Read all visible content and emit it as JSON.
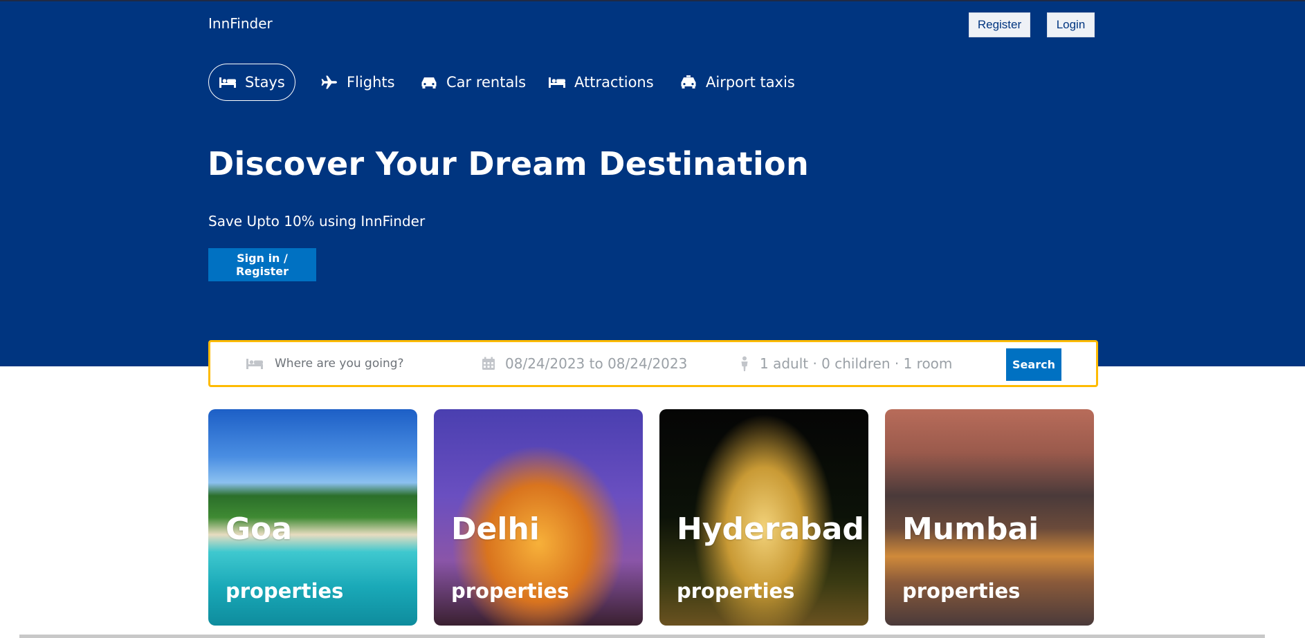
{
  "header": {
    "logo": "InnFinder",
    "register_label": "Register",
    "login_label": "Login"
  },
  "nav": {
    "items": [
      {
        "label": "Stays",
        "icon": "bed-icon",
        "active": true
      },
      {
        "label": "Flights",
        "icon": "plane-icon"
      },
      {
        "label": "Car rentals",
        "icon": "car-icon"
      },
      {
        "label": "Attractions",
        "icon": "bed-icon"
      },
      {
        "label": "Airport taxis",
        "icon": "taxi-icon"
      }
    ]
  },
  "hero": {
    "title": "Discover Your Dream Destination",
    "subtitle": "Save Upto 10% using InnFinder",
    "cta_label": "Sign in / Register"
  },
  "search": {
    "destination_placeholder": "Where are you going?",
    "dates": "08/24/2023 to 08/24/2023",
    "guests": "1 adult · 0 children · 1 room",
    "button_label": "Search"
  },
  "cities": [
    {
      "name": "Goa",
      "sub": "properties"
    },
    {
      "name": "Delhi",
      "sub": "properties"
    },
    {
      "name": "Hyderabad",
      "sub": "properties"
    },
    {
      "name": "Mumbai",
      "sub": "properties"
    }
  ],
  "colors": {
    "hero_bg": "#003580",
    "primary_button": "#0071c2",
    "search_border": "#febb02"
  }
}
